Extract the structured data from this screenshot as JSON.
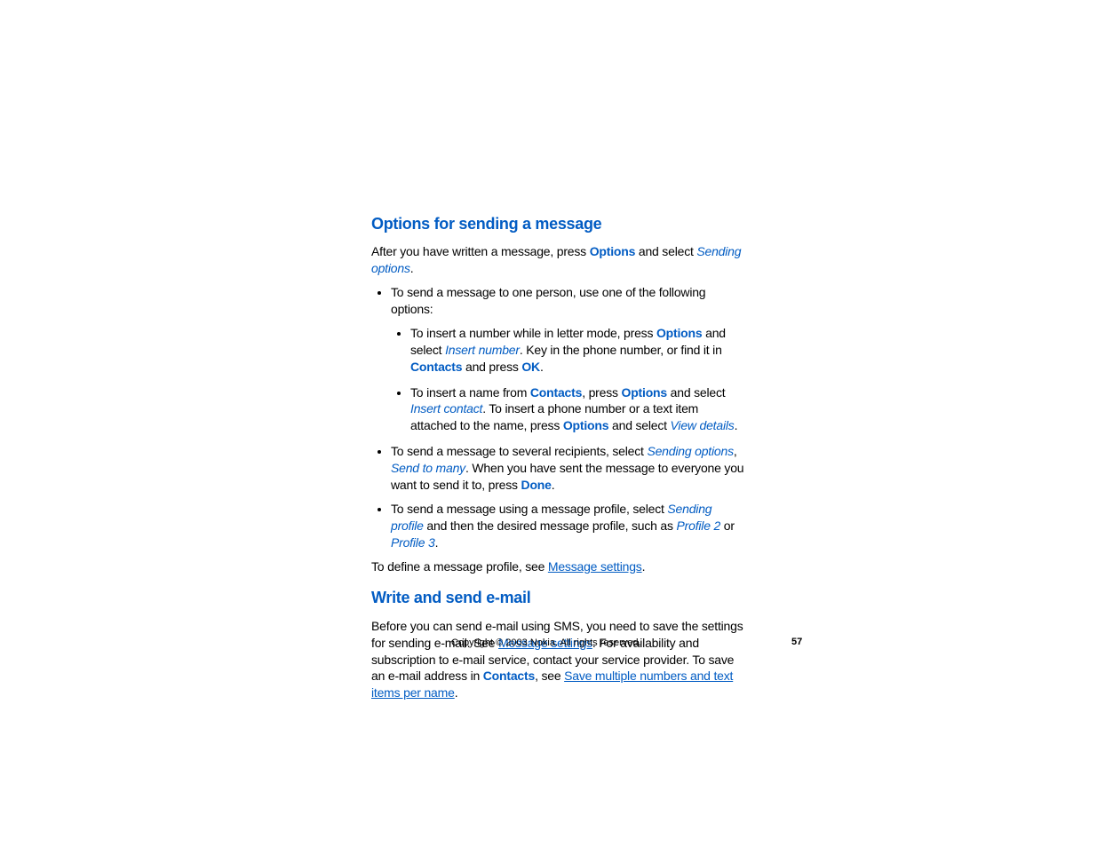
{
  "h1": "Options for sending a message",
  "p1a": "After you have written a message, press ",
  "options": "Options",
  "p1b": " and select ",
  "sending_options": "Sending options",
  "period": ".",
  "li1": "To send a message to one person, use one of the following options:",
  "li1a_1": "To insert a number while in letter mode, press ",
  "li1a_2": " and select ",
  "insert_number": "Insert number",
  "li1a_3": ". Key in the phone number, or find it in ",
  "contacts": "Contacts",
  "li1a_4": " and press ",
  "ok": "OK",
  "li1b_1": "To insert a name from ",
  "li1b_2": ", press ",
  "li1b_3": " and select ",
  "insert_contact": "Insert contact",
  "li1b_4": ". To insert a phone number or a text item attached to the name, press ",
  "li1b_5": " and select ",
  "view_details": "View details",
  "li2_1": "To send a message to several recipients, select ",
  "li2_2": ", ",
  "send_to_many": "Send to many",
  "li2_3": ". When you have sent the message to everyone you want to send it to, press ",
  "done": "Done",
  "li3_1": "To send a message using a message profile, select ",
  "sending_profile": "Sending profile",
  "li3_2": " and then the desired message profile, such as ",
  "profile2": "Profile 2",
  "li3_3": " or ",
  "profile3": "Profile 3",
  "p2a": "To define a message profile, see ",
  "msg_settings": "Message settings",
  "h2": "Write and send e-mail",
  "p3a": "Before you can send e-mail using SMS, you need to save the settings for sending e-mail. See ",
  "p3b": ". For availability and subscription to e-mail service, contact your service provider. To save an e-mail address in ",
  "p3c": ", see ",
  "save_link": "Save multiple numbers and text items per name",
  "footer": "Copyright © 2003 Nokia. All rights reserved.",
  "pagenum": "57"
}
